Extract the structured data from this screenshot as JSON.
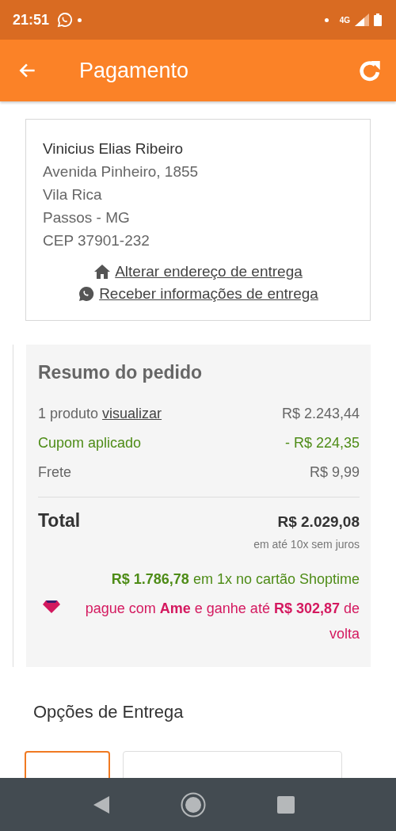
{
  "status_bar": {
    "time": "21:51",
    "network": "4G"
  },
  "app_bar": {
    "title": "Pagamento"
  },
  "address": {
    "lines": [
      "Vinicius Elias Ribeiro",
      "Avenida Pinheiro, 1855",
      "Vila Rica",
      "Passos - MG",
      "CEP 37901-232"
    ],
    "links": [
      {
        "kind": "home",
        "label": " Alterar endereço de entrega"
      },
      {
        "kind": "whatsapp",
        "label": " Receber informações de entrega"
      }
    ]
  },
  "summary": {
    "title": "Resumo do pedido",
    "rows": [
      {
        "kind": "plain",
        "label": "1 produto",
        "link": "visualizar",
        "value": "R$ 2.243,44"
      },
      {
        "kind": "discount",
        "label": "Cupom aplicado",
        "value": "- R$ 224,35"
      },
      {
        "kind": "plain",
        "label": "Frete",
        "value": "R$ 9,99"
      }
    ],
    "total_label": "Total",
    "total_value": "R$ 2.029,08",
    "installments": "em até 10x sem juros",
    "card_offer": "**R$ 1.786,78** em 1x no cartão Shoptime",
    "ame_offer": "pague com **Ame** e ganhe até **R$ 302,87** de volta"
  },
  "delivery": {
    "title": "Opções de Entrega",
    "options": [
      {
        "selected": true
      },
      {
        "selected": false
      }
    ]
  }
}
